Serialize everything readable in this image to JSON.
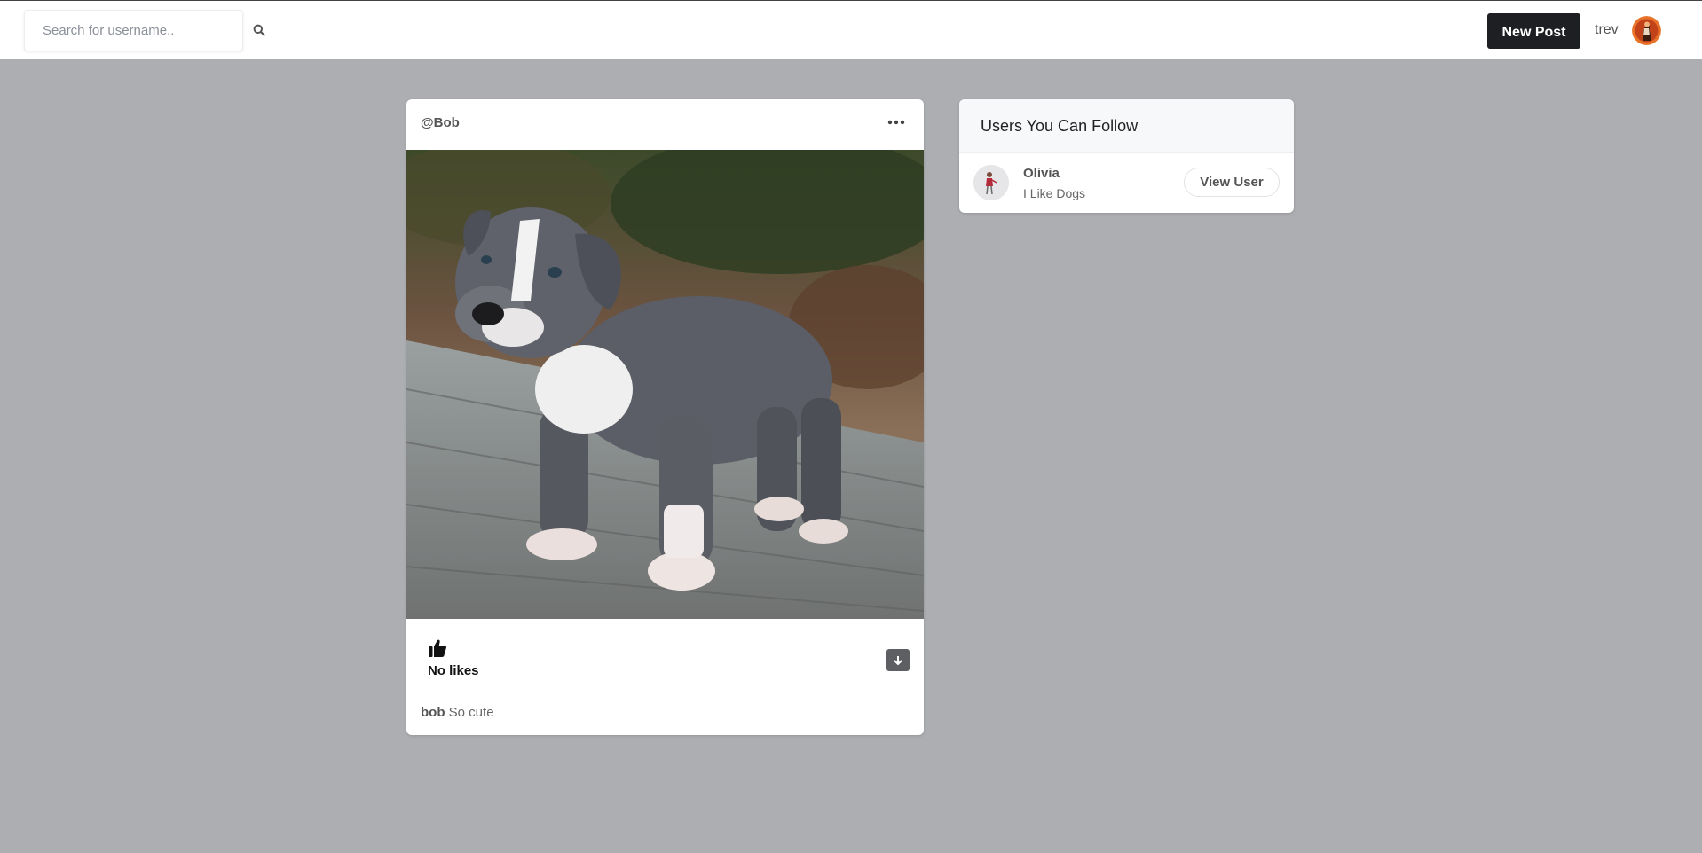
{
  "header": {
    "search_placeholder": "Search for username..",
    "search_value": "",
    "new_post_label": "New Post",
    "current_user": "trev",
    "icons": {
      "search": "search-icon",
      "avatar": "user-avatar"
    }
  },
  "post": {
    "author_handle": "@Bob",
    "menu_icon": "ellipsis-icon",
    "image_subject": "dog-photo",
    "like_icon": "thumbs-up-icon",
    "likes_text": "No likes",
    "download_icon": "download-icon",
    "caption_user": "bob",
    "caption_text": "So cute"
  },
  "suggestions": {
    "title": "Users You Can Follow",
    "users": [
      {
        "name": "Olivia",
        "bio": "I Like Dogs",
        "button_label": "View User"
      }
    ]
  },
  "colors": {
    "page_background": "#acaeb2",
    "primary_button": "#1d1f23",
    "card_background": "#ffffff"
  }
}
